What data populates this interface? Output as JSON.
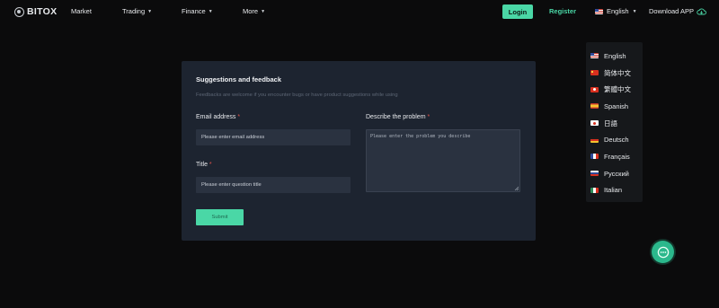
{
  "brand": {
    "name": "BITOX"
  },
  "nav": {
    "market": "Market",
    "trading": "Trading",
    "finance": "Finance",
    "more": "More",
    "login": "Login",
    "register": "Register",
    "language": "English",
    "download": "Download APP"
  },
  "languages": [
    {
      "label": "English",
      "flag": "us"
    },
    {
      "label": "简体中文",
      "flag": "cn"
    },
    {
      "label": "繁體中文",
      "flag": "hk"
    },
    {
      "label": "Spanish",
      "flag": "es"
    },
    {
      "label": "日語",
      "flag": "jp"
    },
    {
      "label": "Deutsch",
      "flag": "de"
    },
    {
      "label": "Français",
      "flag": "fr"
    },
    {
      "label": "Русский",
      "flag": "ru"
    },
    {
      "label": "Italian",
      "flag": "it"
    }
  ],
  "feedback": {
    "title": "Suggestions and feedback",
    "subtitle": "Feedbacks are welcome if you encounter bugs or have product suggestions while using",
    "email_label": "Email address",
    "email_placeholder": "Please enter email address",
    "title_label": "Title",
    "title_placeholder": "Please enter question title",
    "problem_label": "Describe the problem",
    "problem_placeholder": "Please enter the problem you describe",
    "required_mark": "*",
    "submit": "Submit"
  },
  "colors": {
    "accent": "#4ad7a6",
    "background": "#0b0b0c",
    "card": "#1d2430",
    "input": "#2a3240",
    "required": "#e0524a"
  }
}
